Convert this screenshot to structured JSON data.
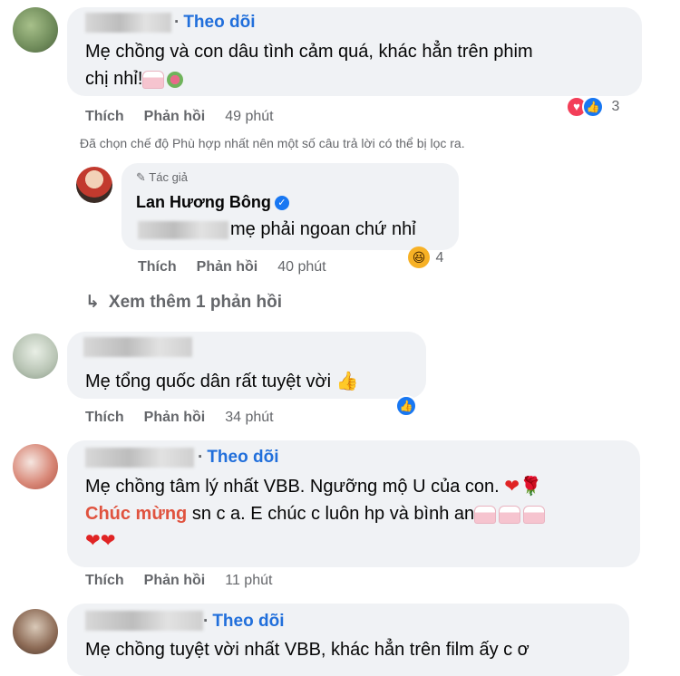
{
  "comment1": {
    "follow": "Theo dõi",
    "text_line1": "Mẹ chồng và con dâu tình cảm quá, khác hẳn trên phim",
    "text_line2": "chị nhỉ!",
    "reaction_count": "3",
    "like_label": "Thích",
    "reply_label": "Phản hồi",
    "time": "49 phút"
  },
  "filter_note": "Đã chọn chế độ Phù hợp nhất nên một số câu trả lời có thể bị lọc ra.",
  "reply1": {
    "badge": "Tác giả",
    "author": "Lan Hương Bông",
    "text": "mẹ phải ngoan chứ nhỉ",
    "reaction_count": "4",
    "like_label": "Thích",
    "reply_label": "Phản hồi",
    "time": "40 phút"
  },
  "see_more": "Xem thêm 1 phản hồi",
  "comment2": {
    "text": "Mẹ tổng quốc dân rất tuyệt vời",
    "like_label": "Thích",
    "reply_label": "Phản hồi",
    "time": "34 phút"
  },
  "comment3": {
    "follow": "Theo dõi",
    "text_line1": "Mẹ chồng tâm lý nhất VBB. Ngưỡng mộ U của con.",
    "highlight": "Chúc mừng",
    "text_line2_rest": " sn c a. E chúc c luôn hp và bình an",
    "like_label": "Thích",
    "reply_label": "Phản hồi",
    "time": "11 phút"
  },
  "comment4": {
    "follow": "Theo dõi",
    "text_line1": "Mẹ chồng tuyệt vời nhất VBB, khác hẳn trên film ấy c ơ"
  },
  "colors": {
    "bubble": "#f0f2f5",
    "link_blue": "#216fdb",
    "secondary_text": "#65676b",
    "highlight_red": "#e0533f"
  }
}
